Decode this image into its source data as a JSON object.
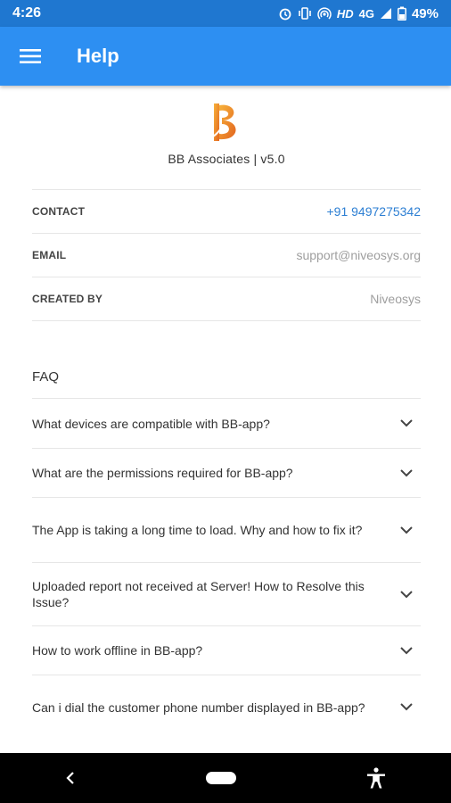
{
  "status": {
    "time": "4:26",
    "network": "HD",
    "signal": "4G",
    "battery": "49%"
  },
  "header": {
    "title": "Help",
    "menu_icon": "menu-icon",
    "color": "#2d8ff2"
  },
  "about": {
    "logo_text": "B",
    "app_name": "BB Associates | v5.0"
  },
  "info": [
    {
      "label": "CONTACT",
      "value": "+91 9497275342"
    },
    {
      "label": "EMAIL",
      "value": "support@niveosys.org"
    },
    {
      "label": "CREATED BY",
      "value": "Niveosys"
    }
  ],
  "faq": {
    "title": "FAQ",
    "items": [
      "What devices are compatible with BB-app?",
      "What are the permissions required for BB-app?",
      "The App is taking a long time to load. Why and how to fix it?",
      "Uploaded report not received at Server! How to Resolve this Issue?",
      "How to work offline in BB-app?",
      "Can i dial the customer phone number displayed in BB-app?"
    ]
  },
  "nav": {
    "back_icon": "back-icon",
    "home_icon": "home-icon",
    "accessibility_icon": "accessibility-icon"
  }
}
